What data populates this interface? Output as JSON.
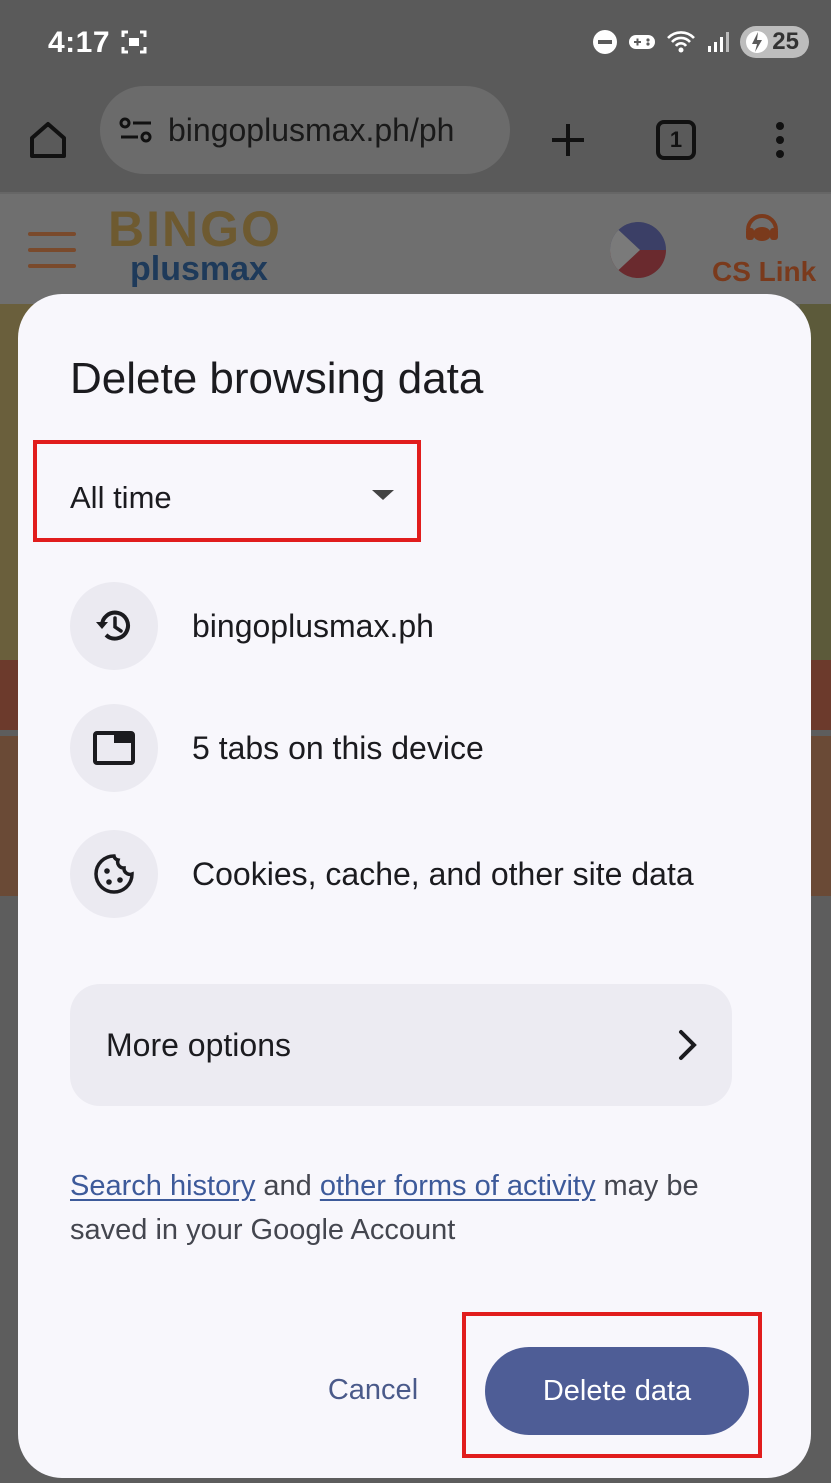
{
  "status_bar": {
    "time": "4:17",
    "battery": "25"
  },
  "browser": {
    "url": "bingoplusmax.ph/ph",
    "tab_count": "1"
  },
  "site": {
    "logo_top": "BINGO",
    "logo_bottom": "plusmax",
    "cs_link": "CS Link"
  },
  "dialog": {
    "title": "Delete browsing data",
    "time_range": "All time",
    "items": [
      {
        "label": "bingoplusmax.ph",
        "icon": "history-icon"
      },
      {
        "label": "5 tabs on this device",
        "icon": "tab-icon"
      },
      {
        "label": "Cookies, cache, and other site data",
        "icon": "cookie-icon"
      }
    ],
    "more_options": "More options",
    "footnote": {
      "link1": "Search history",
      "text1": " and ",
      "link2": "other forms of activity",
      "text2": " may be saved in your Google Account"
    },
    "cancel_label": "Cancel",
    "delete_label": "Delete data"
  },
  "colors": {
    "primary": "#4e5d96",
    "highlight": "#e11d1d",
    "dialog_bg": "#f8f7fc"
  }
}
